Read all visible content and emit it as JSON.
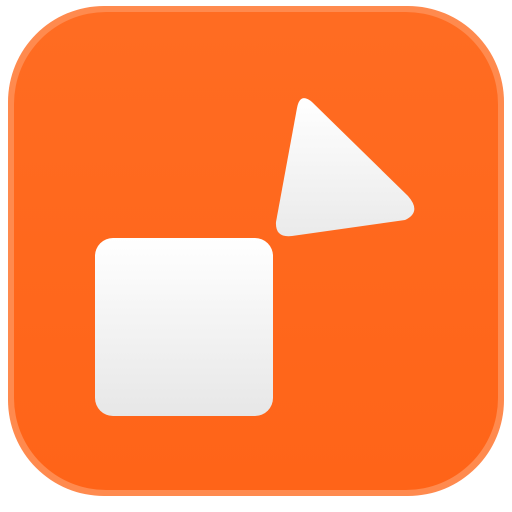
{
  "app_icon": {
    "name": "orange-shapes-app-icon",
    "colors": {
      "background": "#FF6418",
      "background_highlight": "#FF8A4E",
      "shape_fill_top": "#FFFFFF",
      "shape_fill_bottom": "#E7E7E7"
    },
    "glyphs": [
      "rounded-square-shape-icon",
      "triangle-shape-icon"
    ]
  }
}
